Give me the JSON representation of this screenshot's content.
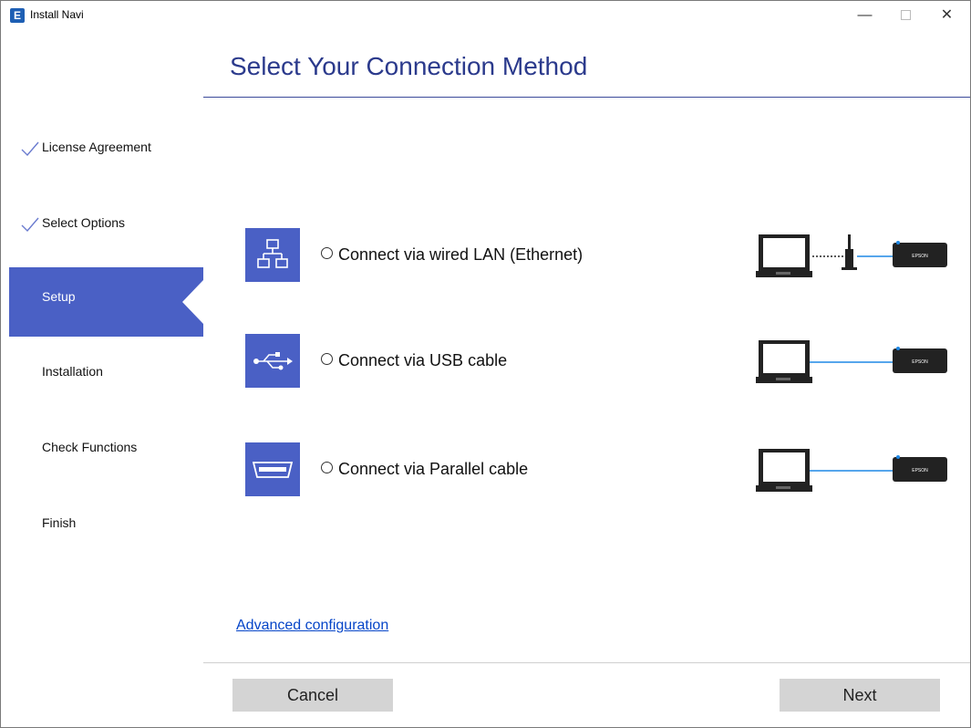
{
  "window": {
    "app_icon_letter": "E",
    "title": "Install Navi",
    "minimize_glyph": "—",
    "close_glyph": "✕"
  },
  "header": {
    "title": "Select Your Connection Method"
  },
  "sidebar": {
    "steps": [
      {
        "label": "License Agreement",
        "state": "done"
      },
      {
        "label": "Select Options",
        "state": "done"
      },
      {
        "label": "Setup",
        "state": "active"
      },
      {
        "label": "Installation",
        "state": "pending"
      },
      {
        "label": "Check Functions",
        "state": "pending"
      },
      {
        "label": "Finish",
        "state": "pending"
      }
    ]
  },
  "options": [
    {
      "label": "Connect via wired LAN (Ethernet)",
      "icon": "network-icon",
      "selected": false
    },
    {
      "label": "Connect via USB cable",
      "icon": "usb-icon",
      "selected": false
    },
    {
      "label": "Connect via Parallel cable",
      "icon": "parallel-port-icon",
      "selected": false
    }
  ],
  "diagram": {
    "printer_brand": "EPSON"
  },
  "links": {
    "advanced": "Advanced configuration"
  },
  "footer": {
    "cancel_label": "Cancel",
    "next_label": "Next"
  },
  "colors": {
    "accent": "#4a60c5",
    "heading": "#2b3a8c",
    "link": "#0645c8",
    "cable": "#1e88e5"
  }
}
